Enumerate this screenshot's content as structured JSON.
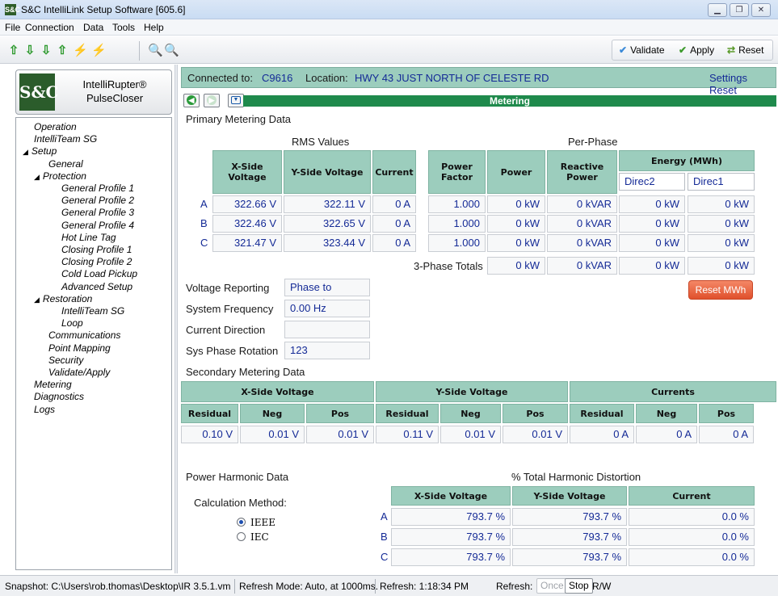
{
  "window": {
    "title": "S&C IntelliLink Setup Software [605.6]",
    "app_icon_text": "S&C"
  },
  "menu": [
    "File",
    "Connection",
    "Data",
    "Tools",
    "Help"
  ],
  "toolbar": {
    "validate": "Validate",
    "apply": "Apply",
    "reset": "Reset"
  },
  "product": {
    "logo": "S&C",
    "line1": "IntelliRupter®",
    "line2": "PulseCloser"
  },
  "nav": [
    {
      "label": "Operation",
      "arrow": ""
    },
    {
      "label": "IntelliTeam SG",
      "arrow": ""
    },
    {
      "label": "Setup",
      "arrow": "◢"
    },
    {
      "label": "General",
      "arrow": ""
    },
    {
      "label": "Protection",
      "arrow": "◢"
    },
    {
      "label": "General Profile 1",
      "arrow": ""
    },
    {
      "label": "General Profile 2",
      "arrow": ""
    },
    {
      "label": "General Profile 3",
      "arrow": ""
    },
    {
      "label": "General Profile 4",
      "arrow": ""
    },
    {
      "label": "Hot Line Tag",
      "arrow": ""
    },
    {
      "label": "Closing Profile 1",
      "arrow": ""
    },
    {
      "label": "Closing Profile 2",
      "arrow": ""
    },
    {
      "label": "Cold Load Pickup",
      "arrow": ""
    },
    {
      "label": "Advanced Setup",
      "arrow": ""
    },
    {
      "label": "Restoration",
      "arrow": "◢"
    },
    {
      "label": "IntelliTeam SG",
      "arrow": ""
    },
    {
      "label": "Loop",
      "arrow": ""
    },
    {
      "label": "Communications",
      "arrow": ""
    },
    {
      "label": "Point Mapping",
      "arrow": ""
    },
    {
      "label": "Security",
      "arrow": ""
    },
    {
      "label": "Validate/Apply",
      "arrow": ""
    },
    {
      "label": "Metering",
      "arrow": ""
    },
    {
      "label": "Diagnostics",
      "arrow": ""
    },
    {
      "label": "Logs",
      "arrow": ""
    }
  ],
  "connection": {
    "connected_label": "Connected to:",
    "connected_value": "C9616",
    "location_label": "Location:",
    "location_value": "HWY 43 JUST NORTH OF CELESTE RD",
    "settings_reset": "Settings Reset"
  },
  "page_title": "Metering",
  "primary": {
    "title": "Primary Metering Data",
    "rms_title": "RMS Values",
    "perphase_title": "Per-Phase",
    "headers": {
      "xv": "X-Side Voltage",
      "yv": "Y-Side Voltage",
      "cur": "Current",
      "pf": "Power Factor",
      "pw": "Power",
      "rp": "Reactive Power",
      "energy": "Energy (MWh)",
      "dir2": "Direc2",
      "dir1": "Direc1"
    },
    "rows": [
      {
        "phase": "A",
        "xv": "322.66 V",
        "yv": "322.11 V",
        "cur": "0 A",
        "pf": "1.000",
        "pw": "0 kW",
        "rp": "0 kVAR",
        "e2": "0 kW",
        "e1": "0 kW"
      },
      {
        "phase": "B",
        "xv": "322.46 V",
        "yv": "322.65 V",
        "cur": "0 A",
        "pf": "1.000",
        "pw": "0 kW",
        "rp": "0 kVAR",
        "e2": "0 kW",
        "e1": "0 kW"
      },
      {
        "phase": "C",
        "xv": "321.47 V",
        "yv": "323.44 V",
        "cur": "0 A",
        "pf": "1.000",
        "pw": "0 kW",
        "rp": "0 kVAR",
        "e2": "0 kW",
        "e1": "0 kW"
      }
    ],
    "totals": {
      "label": "3-Phase Totals",
      "pw": "0 kW",
      "rp": "0 kVAR",
      "e2": "0 kW",
      "e1": "0 kW"
    },
    "reset_mwh": "Reset MWh"
  },
  "settings": [
    {
      "label": "Voltage Reporting",
      "value": "Phase to Ground"
    },
    {
      "label": "System Frequency",
      "value": "0.00 Hz"
    },
    {
      "label": "Current Direction",
      "value": ""
    },
    {
      "label": "Sys Phase Rotation",
      "value": "123"
    }
  ],
  "secondary": {
    "title": "Secondary Metering Data",
    "groups": [
      "X-Side Voltage",
      "Y-Side Voltage",
      "Currents"
    ],
    "sub": [
      "Residual",
      "Neg",
      "Pos"
    ],
    "values": [
      "0.10 V",
      "0.01 V",
      "0.01 V",
      "0.11 V",
      "0.01 V",
      "0.01 V",
      "0 A",
      "0 A",
      "0 A"
    ]
  },
  "harmonic": {
    "title": "Power Harmonic Data",
    "thd_title": "% Total Harmonic Distortion",
    "calc_label": "Calculation Method:",
    "options": [
      "IEEE",
      "IEC"
    ],
    "selected": "IEEE",
    "headers": [
      "X-Side Voltage",
      "Y-Side Voltage",
      "Current"
    ],
    "rows": [
      {
        "phase": "A",
        "xv": "793.7 %",
        "yv": "793.7 %",
        "cur": "0.0 %"
      },
      {
        "phase": "B",
        "xv": "793.7 %",
        "yv": "793.7 %",
        "cur": "0.0 %"
      },
      {
        "phase": "C",
        "xv": "793.7 %",
        "yv": "793.7 %",
        "cur": "0.0 %"
      }
    ]
  },
  "status": {
    "snapshot": "Snapshot: C:\\Users\\rob.thomas\\Desktop\\IR 3.5.1.vm",
    "refresh_mode": "Refresh Mode: Auto, at 1000ms.",
    "refresh_time": "Refresh: 1:18:34 PM",
    "refresh_label": "Refresh:",
    "once": "Once",
    "stop": "Stop",
    "rw": "R/W"
  }
}
